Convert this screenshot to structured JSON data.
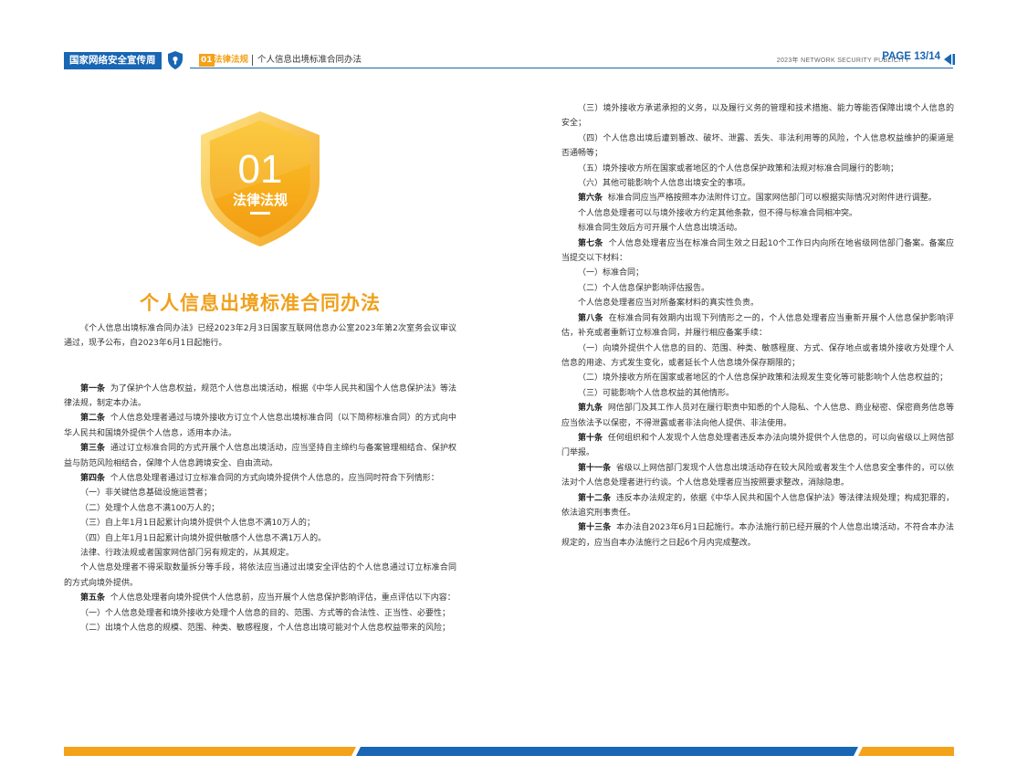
{
  "header": {
    "brand": "国家网络安全宣传周",
    "section_num": "01",
    "section_name": "法律法规",
    "doc_title": "个人信息出境标准合同办法",
    "right_text": "2023年  NETWORK SECURITY PUBLICITY",
    "page": "PAGE  13/14",
    "shield_icon": "shield-lock-icon",
    "arrow_icon": "triangle-left-icon",
    "brand_color": "#1866b4",
    "accent_color": "#f3a21a"
  },
  "badge": {
    "num": "01",
    "label": "法律法规"
  },
  "title": "个人信息出境标准合同办法",
  "left": [
    "《个人信息出境标准合同办法》已经2023年2月3日国家互联网信息办公室2023年第2次室务会议审议通过，现予公布，自2023年6月1日起施行。",
    "",
    "",
    "",
    "第二条",
    "个人信息处理者通过与境外接收方订立个人信息出境标准合同（以下简称标准合同）的方式向中华人民共和国境外提供个人信息，适用本办法。",
    "第三条",
    "通过订立标准合同的方式开展个人信息出境活动，应当坚持自主缔约与备案管理相结合、保护权益与防范风险相结合，保障个人信息跨境安全、自由流动。",
    "第四条",
    "个人信息处理者通过订立标准合同的方式向境外提供个人信息的，应当同时符合下列情形：",
    "（一）非关键信息基础设施运营者；",
    "（二）处理个人信息不满100万人的；",
    "（三）自上年1月1日起累计向境外提供个人信息不满10万人的；",
    "（四）自上年1月1日起累计向境外提供敏感个人信息不满1万人的。",
    "法律、行政法规或者国家网信部门另有规定的，从其规定。",
    "个人信息处理者不得采取数量拆分等手段，将依法应当通过出境安全评估的个人信息通过订立标准合同的方式向境外提供。",
    "第五条",
    "个人信息处理者向境外提供个人信息前，应当开展个人信息保护影响评估，重点评估以下内容：",
    "（一）个人信息处理者和境外接收方处理个人信息的目的、范围、方式等的合法性、正当性、必要性；",
    "（二）出境个人信息的规模、范围、种类、敏感程度，个人信息出境可能对个人信息权益带来的风险；"
  ],
  "article1": {
    "label": "第一条",
    "text": "为了保护个人信息权益，规范个人信息出境活动，根据《中华人民共和国个人信息保护法》等法律法规，制定本办法。"
  },
  "right": [
    "（三）境外接收方承诺承担的义务，以及履行义务的管理和技术措施、能力等能否保障出境个人信息的安全；",
    "（四）个人信息出境后遭到篡改、破坏、泄露、丢失、非法利用等的风险，个人信息权益维护的渠道是否通畅等；",
    "（五）境外接收方所在国家或者地区的个人信息保护政策和法规对标准合同履行的影响；",
    "（六）其他可能影响个人信息出境安全的事项。",
    "第六条",
    "标准合同应当严格按照本办法附件订立。国家网信部门可以根据实际情况对附件进行调整。",
    "个人信息处理者可以与境外接收方约定其他条款，但不得与标准合同相冲突。",
    "标准合同生效后方可开展个人信息出境活动。",
    "第七条",
    "个人信息处理者应当在标准合同生效之日起10个工作日内向所在地省级网信部门备案。备案应当提交以下材料：",
    "（一）标准合同；",
    "（二）个人信息保护影响评估报告。",
    "个人信息处理者应当对所备案材料的真实性负责。",
    "第八条",
    "在标准合同有效期内出现下列情形之一的，个人信息处理者应当重新开展个人信息保护影响评估，补充或者重新订立标准合同，并履行相应备案手续：",
    "（一）向境外提供个人信息的目的、范围、种类、敏感程度、方式、保存地点或者境外接收方处理个人信息的用途、方式发生变化，或者延长个人信息境外保存期限的；",
    "（二）境外接收方所在国家或者地区的个人信息保护政策和法规发生变化等可能影响个人信息权益的；",
    "（三）可能影响个人信息权益的其他情形。",
    "第九条",
    "网信部门及其工作人员对在履行职责中知悉的个人隐私、个人信息、商业秘密、保密商务信息等应当依法予以保密，不得泄露或者非法向他人提供、非法使用。",
    "第十条",
    "任何组织和个人发现个人信息处理者违反本办法向境外提供个人信息的，可以向省级以上网信部门举报。",
    "第十一条",
    "省级以上网信部门发现个人信息出境活动存在较大风险或者发生个人信息安全事件的，可以依法对个人信息处理者进行约谈。个人信息处理者应当按照要求整改，消除隐患。",
    "第十二条",
    "违反本办法规定的，依据《中华人民共和国个人信息保护法》等法律法规处理；构成犯罪的，依法追究刑事责任。",
    "第十三条",
    "本办法自2023年6月1日起施行。本办法施行前已经开展的个人信息出境活动，不符合本办法规定的，应当自本办法施行之日起6个月内完成整改。"
  ]
}
